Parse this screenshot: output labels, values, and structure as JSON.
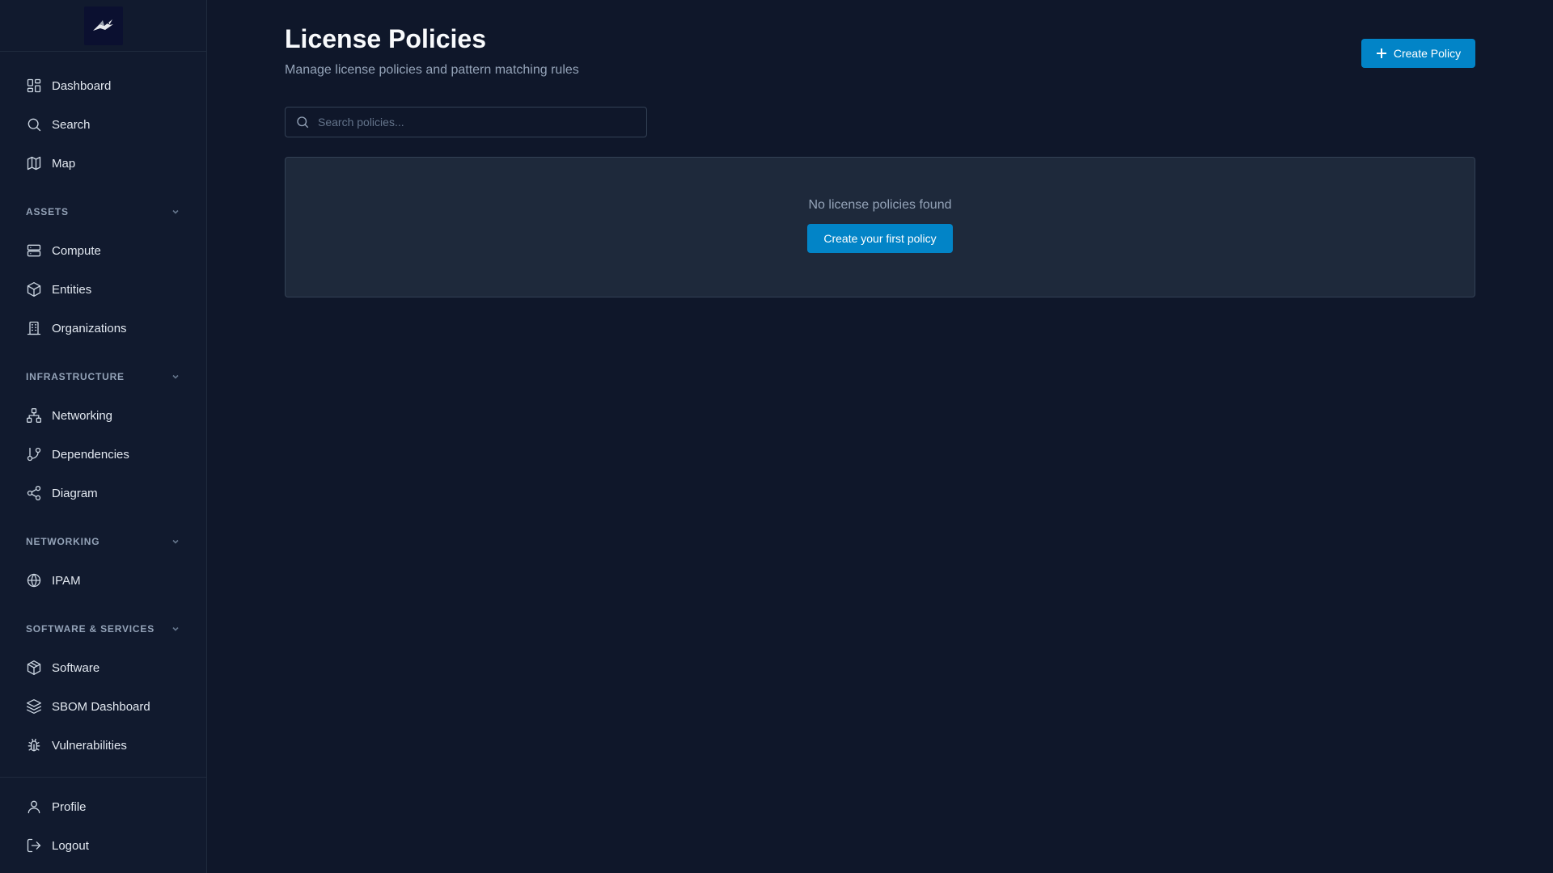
{
  "sidebar": {
    "logo_alt": "App logo",
    "top_items": [
      {
        "label": "Dashboard",
        "icon": "dashboard-icon"
      },
      {
        "label": "Search",
        "icon": "search-icon"
      },
      {
        "label": "Map",
        "icon": "map-icon"
      }
    ],
    "sections": [
      {
        "title": "ASSETS",
        "items": [
          {
            "label": "Compute",
            "icon": "server-icon"
          },
          {
            "label": "Entities",
            "icon": "cube-icon"
          },
          {
            "label": "Organizations",
            "icon": "building-icon"
          }
        ]
      },
      {
        "title": "INFRASTRUCTURE",
        "items": [
          {
            "label": "Networking",
            "icon": "network-icon"
          },
          {
            "label": "Dependencies",
            "icon": "git-branch-icon"
          },
          {
            "label": "Diagram",
            "icon": "share-icon"
          }
        ]
      },
      {
        "title": "NETWORKING",
        "items": [
          {
            "label": "IPAM",
            "icon": "globe-icon"
          }
        ]
      },
      {
        "title": "SOFTWARE & SERVICES",
        "items": [
          {
            "label": "Software",
            "icon": "package-icon"
          },
          {
            "label": "SBOM Dashboard",
            "icon": "layers-icon"
          },
          {
            "label": "Vulnerabilities",
            "icon": "bug-icon"
          }
        ]
      }
    ],
    "footer_items": [
      {
        "label": "Profile",
        "icon": "user-icon"
      },
      {
        "label": "Logout",
        "icon": "logout-icon"
      }
    ]
  },
  "header": {
    "title": "License Policies",
    "subtitle": "Manage license policies and pattern matching rules",
    "create_button": "Create Policy"
  },
  "search": {
    "placeholder": "Search policies...",
    "value": ""
  },
  "empty_state": {
    "message": "No license policies found",
    "button": "Create your first policy"
  },
  "colors": {
    "background": "#0f172a",
    "sidebar": "#111a2e",
    "card": "#1e293b",
    "accent": "#0284c7"
  }
}
